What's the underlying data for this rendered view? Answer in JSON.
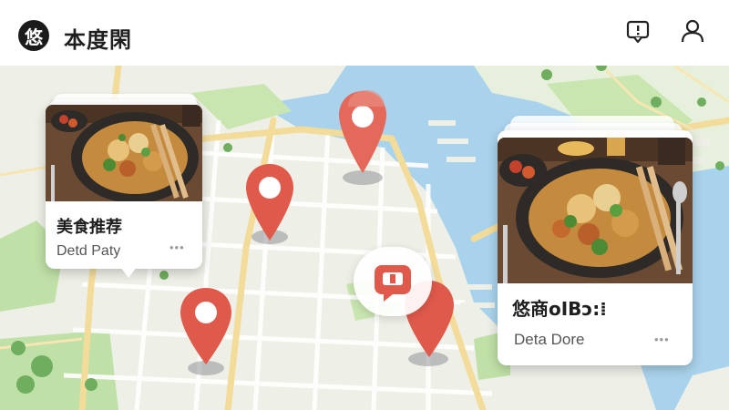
{
  "header": {
    "logo_char": "悠",
    "title": "本度閑",
    "icons": [
      "message-icon",
      "user-icon"
    ]
  },
  "colors": {
    "map_water": "#a9d3ec",
    "map_land": "#eef0e8",
    "map_park": "#bfe0a6",
    "map_road": "#f3dc9a",
    "pin": "#e05a4b"
  },
  "cards": {
    "left": {
      "title": "美食推荐",
      "subtitle": "Detd Paty",
      "more": "•••"
    },
    "right": {
      "title": "悠商oIBɔ:⁞",
      "subtitle": "Deta Dore",
      "more": "•••"
    }
  }
}
